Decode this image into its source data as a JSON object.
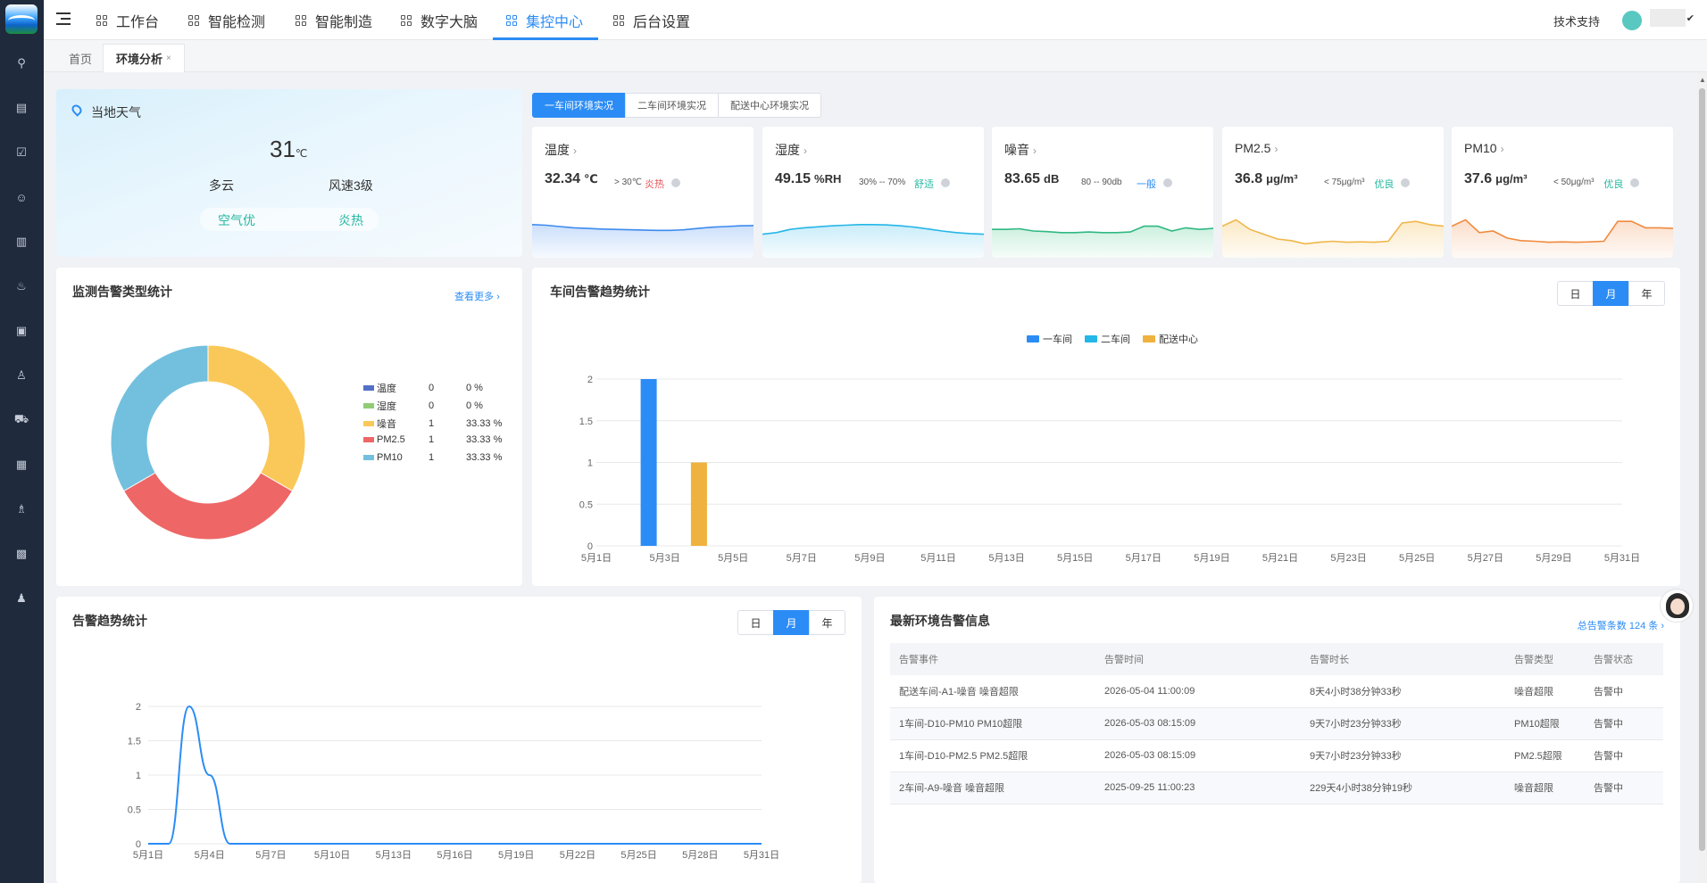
{
  "nav": {
    "items": [
      "工作台",
      "智能检测",
      "智能制造",
      "数字大脑",
      "集控中心",
      "后台设置"
    ],
    "active_index": 4,
    "tech_support": "技术支持"
  },
  "tabs": [
    {
      "label": "首页",
      "active": false
    },
    {
      "label": "环境分析",
      "active": true,
      "close": "×"
    }
  ],
  "weather": {
    "title": "当地天气",
    "temp": "31",
    "temp_unit": "℃",
    "condition": "多云",
    "wind": "风速3级",
    "air": "空气优",
    "heat": "炎热"
  },
  "workshop_tabs": [
    "一车间环境实况",
    "二车间环境实况",
    "配送中心环境实况"
  ],
  "workshop_tab_active": 0,
  "metrics": [
    {
      "label": "温度",
      "value": "32.34",
      "unit": "℃",
      "range": "> 30℃",
      "status": "炎热",
      "status_color": "#e8545a",
      "color": "#3d8bef",
      "fill": "#c8ddfa",
      "series": [
        0.3,
        0.32,
        0.36,
        0.4,
        0.42,
        0.44,
        0.45,
        0.46,
        0.47,
        0.48,
        0.48,
        0.46,
        0.42,
        0.38,
        0.36,
        0.34,
        0.33
      ]
    },
    {
      "label": "湿度",
      "value": "49.15",
      "unit": "%RH",
      "range": "30% -- 70%",
      "status": "舒适",
      "status_color": "#26b8a0",
      "color": "#25b6e8",
      "fill": "#c7ecf9",
      "series": [
        0.6,
        0.55,
        0.45,
        0.4,
        0.37,
        0.34,
        0.32,
        0.3,
        0.3,
        0.31,
        0.34,
        0.38,
        0.44,
        0.5,
        0.55,
        0.58,
        0.6
      ]
    },
    {
      "label": "噪音",
      "value": "83.65",
      "unit": "dB",
      "range": "80 -- 90db",
      "status": "一般",
      "status_color": "#2b8cf5",
      "color": "#2fb882",
      "fill": "#c9efdd",
      "series": [
        0.45,
        0.45,
        0.43,
        0.5,
        0.52,
        0.55,
        0.55,
        0.53,
        0.55,
        0.55,
        0.53,
        0.35,
        0.35,
        0.5,
        0.4,
        0.45,
        0.42
      ]
    },
    {
      "label": "PM2.5",
      "value": "36.8",
      "unit": "μg/m³",
      "range": "< 75μg/m³",
      "status": "优良",
      "status_color": "#26b8a0",
      "color": "#f0b64a",
      "fill": "#fbe8c2",
      "series": [
        0.35,
        0.15,
        0.45,
        0.6,
        0.75,
        0.8,
        0.9,
        0.85,
        0.82,
        0.85,
        0.84,
        0.85,
        0.82,
        0.25,
        0.2,
        0.3,
        0.35
      ]
    },
    {
      "label": "PM10",
      "value": "37.6",
      "unit": "μg/m³",
      "range": "< 50μg/m³",
      "status": "优良",
      "status_color": "#26b8a0",
      "color": "#f08a3e",
      "fill": "#fbdcc7",
      "series": [
        0.35,
        0.15,
        0.55,
        0.5,
        0.72,
        0.8,
        0.82,
        0.85,
        0.84,
        0.85,
        0.84,
        0.82,
        0.2,
        0.2,
        0.4,
        0.4,
        0.42
      ]
    }
  ],
  "alarm_types": {
    "title": "监测告警类型统计",
    "more": "查看更多",
    "items": [
      {
        "name": "温度",
        "count": "0",
        "pct": "0 %",
        "value": 0,
        "color": "#5470c6"
      },
      {
        "name": "湿度",
        "count": "0",
        "pct": "0 %",
        "value": 0,
        "color": "#91cc75"
      },
      {
        "name": "噪音",
        "count": "1",
        "pct": "33.33 %",
        "value": 1,
        "color": "#fac858"
      },
      {
        "name": "PM2.5",
        "count": "1",
        "pct": "33.33 %",
        "value": 1,
        "color": "#ee6666"
      },
      {
        "name": "PM10",
        "count": "1",
        "pct": "33.33 %",
        "value": 1,
        "color": "#73c0de"
      }
    ]
  },
  "workshop_trend": {
    "title": "车间告警趋势统计",
    "periods": [
      "日",
      "月",
      "年"
    ],
    "active_period": 1
  },
  "alarm_trend": {
    "title": "告警趋势统计",
    "periods": [
      "日",
      "月",
      "年"
    ],
    "active_period": 1
  },
  "latest_alarms": {
    "title": "最新环境告警信息",
    "total": "总告警条数 124 条",
    "headers": [
      "告警事件",
      "告警时间",
      "告警时长",
      "告警类型",
      "告警状态"
    ],
    "rows": [
      [
        "配送车间-A1-噪音 噪音超限",
        "2026-05-04 11:00:09",
        "8天4小时38分钟33秒",
        "噪音超限",
        "告警中"
      ],
      [
        "1车间-D10-PM10 PM10超限",
        "2026-05-03 08:15:09",
        "9天7小时23分钟33秒",
        "PM10超限",
        "告警中"
      ],
      [
        "1车间-D10-PM2.5 PM2.5超限",
        "2026-05-03 08:15:09",
        "9天7小时23分钟33秒",
        "PM2.5超限",
        "告警中"
      ],
      [
        "2车间-A9-噪音 噪音超限",
        "2025-09-25 11:00:23",
        "229天4小时38分钟19秒",
        "噪音超限",
        "告警中"
      ]
    ]
  },
  "chart_data": [
    {
      "type": "pie",
      "title": "监测告警类型统计",
      "labels": [
        "温度",
        "湿度",
        "噪音",
        "PM2.5",
        "PM10"
      ],
      "values": [
        0,
        0,
        1,
        1,
        1
      ],
      "donut": true,
      "legend": "right"
    },
    {
      "type": "bar",
      "title": "车间告警趋势统计",
      "categories": [
        "5月1日",
        "5月2日",
        "5月3日",
        "5月4日",
        "5月5日",
        "5月6日",
        "5月7日",
        "5月8日",
        "5月9日",
        "5月10日",
        "5月11日",
        "5月12日",
        "5月13日",
        "5月14日",
        "5月15日",
        "5月16日",
        "5月17日",
        "5月18日",
        "5月19日",
        "5月20日",
        "5月21日",
        "5月22日",
        "5月23日",
        "5月24日",
        "5月25日",
        "5月26日",
        "5月27日",
        "5月28日",
        "5月29日",
        "5月30日",
        "5月31日"
      ],
      "x_tick_labels": [
        "5月1日",
        "5月3日",
        "5月5日",
        "5月7日",
        "5月9日",
        "5月11日",
        "5月13日",
        "5月15日",
        "5月17日",
        "5月19日",
        "5月21日",
        "5月23日",
        "5月25日",
        "5月27日",
        "5月29日",
        "5月31日"
      ],
      "series": [
        {
          "name": "一车间",
          "color": "#2b8cf5",
          "values": [
            0,
            0,
            2,
            0,
            0,
            0,
            0,
            0,
            0,
            0,
            0,
            0,
            0,
            0,
            0,
            0,
            0,
            0,
            0,
            0,
            0,
            0,
            0,
            0,
            0,
            0,
            0,
            0,
            0,
            0,
            0
          ]
        },
        {
          "name": "二车间",
          "color": "#25b6e8",
          "values": [
            0,
            0,
            0,
            0,
            0,
            0,
            0,
            0,
            0,
            0,
            0,
            0,
            0,
            0,
            0,
            0,
            0,
            0,
            0,
            0,
            0,
            0,
            0,
            0,
            0,
            0,
            0,
            0,
            0,
            0,
            0
          ]
        },
        {
          "name": "配送中心",
          "color": "#f0b23e",
          "values": [
            0,
            0,
            0,
            1,
            0,
            0,
            0,
            0,
            0,
            0,
            0,
            0,
            0,
            0,
            0,
            0,
            0,
            0,
            0,
            0,
            0,
            0,
            0,
            0,
            0,
            0,
            0,
            0,
            0,
            0,
            0
          ]
        }
      ],
      "y_ticks": [
        "0",
        "0.5",
        "1",
        "1.5",
        "2"
      ],
      "ylim": [
        0,
        2
      ],
      "grid": true,
      "legend": "top"
    },
    {
      "type": "line",
      "title": "告警趋势统计",
      "categories": [
        "5月1日",
        "5月2日",
        "5月3日",
        "5月4日",
        "5月5日",
        "5月6日",
        "5月7日",
        "5月8日",
        "5月9日",
        "5月10日",
        "5月11日",
        "5月12日",
        "5月13日",
        "5月14日",
        "5月15日",
        "5月16日",
        "5月17日",
        "5月18日",
        "5月19日",
        "5月20日",
        "5月21日",
        "5月22日",
        "5月23日",
        "5月24日",
        "5月25日",
        "5月26日",
        "5月27日",
        "5月28日",
        "5月29日",
        "5月30日",
        "5月31日"
      ],
      "x_tick_labels": [
        "5月1日",
        "5月4日",
        "5月7日",
        "5月10日",
        "5月13日",
        "5月16日",
        "5月19日",
        "5月22日",
        "5月25日",
        "5月28日",
        "5月31日"
      ],
      "values": [
        0,
        0,
        2,
        1,
        0,
        0,
        0,
        0,
        0,
        0,
        0,
        0,
        0,
        0,
        0,
        0,
        0,
        0,
        0,
        0,
        0,
        0,
        0,
        0,
        0,
        0,
        0,
        0,
        0,
        0,
        0
      ],
      "color": "#2b8cf5",
      "smooth": true,
      "y_ticks": [
        "0",
        "0.5",
        "1",
        "1.5",
        "2"
      ],
      "ylim": [
        0,
        2
      ],
      "grid": true
    }
  ]
}
